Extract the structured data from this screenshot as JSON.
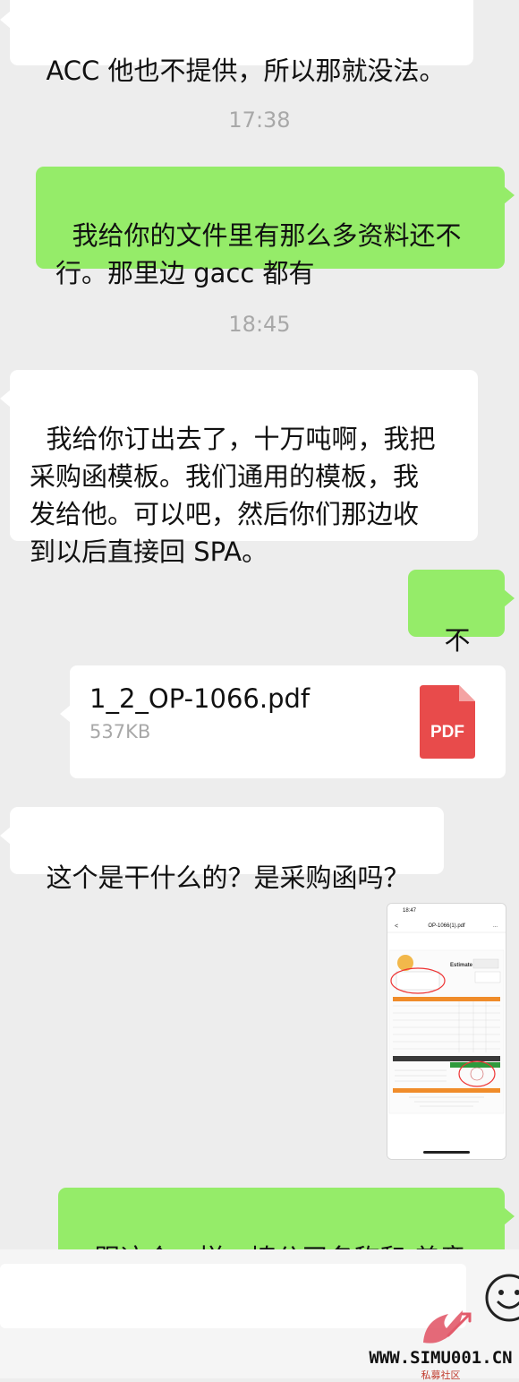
{
  "messages": {
    "m1": "ACC 他也不提供，所以那就没法。",
    "t1": "17:38",
    "m2": "我给你的文件里有那么多资料还不\n行。那里边 gacc 都有",
    "t2": "18:45",
    "m3": "我给你订出去了，十万吨啊，我把\n采购函模板。我们通用的模板，我\n发给他。可以吧，然后你们那边收\n到以后直接回 SPA。",
    "m4": "不是",
    "m5": "这个是干什么的？是采购函吗？",
    "m6": "跟这个一样。填公司名称和 盖章"
  },
  "file": {
    "name": "1_2_OP-1066.pdf",
    "size": "537KB",
    "icon_label": "PDF",
    "icon_color": "#e84b4b"
  },
  "thumbnail": {
    "status_time": "18:47",
    "title": "OP-1066(1).pdf",
    "doc_heading": "Estimate"
  },
  "watermark": {
    "text": "WWW.SIMU001.CN",
    "sub": "私募社区"
  },
  "colors": {
    "outgoing": "#95ec69",
    "incoming": "#ffffff",
    "background": "#ededed"
  }
}
